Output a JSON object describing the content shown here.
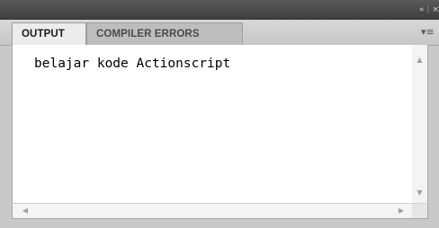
{
  "window": {
    "controls": {
      "collapse_label": "«",
      "separator": "|",
      "close_label": "×"
    }
  },
  "tabs": [
    {
      "label": "OUTPUT",
      "active": true
    },
    {
      "label": "COMPILER ERRORS",
      "active": false
    }
  ],
  "panel_menu": {
    "icon": "panel-menu-icon",
    "glyph": "▾≡"
  },
  "output": {
    "text": "belajar kode Actionscript"
  },
  "scrollbars": {
    "up_glyph": "▲",
    "down_glyph": "▼",
    "left_glyph": "◀",
    "right_glyph": "▶"
  },
  "colors": {
    "titlebar": "#4a4a4a",
    "tab_active": "#ececec",
    "tab_inactive": "#bdbdbd",
    "content_bg": "#ffffff"
  }
}
